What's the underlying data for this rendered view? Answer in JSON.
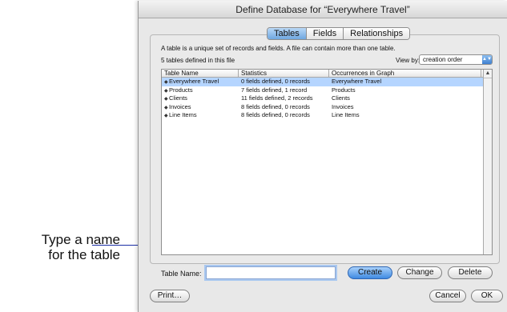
{
  "callout": {
    "line1": "Type a name",
    "line2": "for the table"
  },
  "dialog": {
    "title": "Define Database for “Everywhere Travel”",
    "tabs": [
      {
        "label": "Tables",
        "active": true
      },
      {
        "label": "Fields",
        "active": false
      },
      {
        "label": "Relationships",
        "active": false
      }
    ],
    "description": "A table is a unique set of records and fields. A file can contain more than one table.",
    "count_text": "5 tables defined in this file",
    "view_by": {
      "label": "View by:",
      "selected": "creation order"
    },
    "table": {
      "columns": [
        "Table Name",
        "Statistics",
        "Occurrences in Graph"
      ],
      "rows": [
        {
          "name": "Everywhere Travel",
          "stats": "0 fields defined, 0 records",
          "occurrence": "Everywhere Travel",
          "selected": true
        },
        {
          "name": "Products",
          "stats": "7 fields defined, 1 record",
          "occurrence": "Products",
          "selected": false
        },
        {
          "name": "Clients",
          "stats": "11 fields defined, 2 records",
          "occurrence": "Clients",
          "selected": false
        },
        {
          "name": "Invoices",
          "stats": "8 fields defined, 0 records",
          "occurrence": "Invoices",
          "selected": false
        },
        {
          "name": "Line Items",
          "stats": "8 fields defined, 0 records",
          "occurrence": "Line Items",
          "selected": false
        }
      ]
    },
    "table_name": {
      "label": "Table Name:",
      "value": ""
    },
    "buttons": {
      "create": "Create",
      "change": "Change",
      "delete": "Delete",
      "print": "Print…",
      "cancel": "Cancel",
      "ok": "OK"
    }
  }
}
